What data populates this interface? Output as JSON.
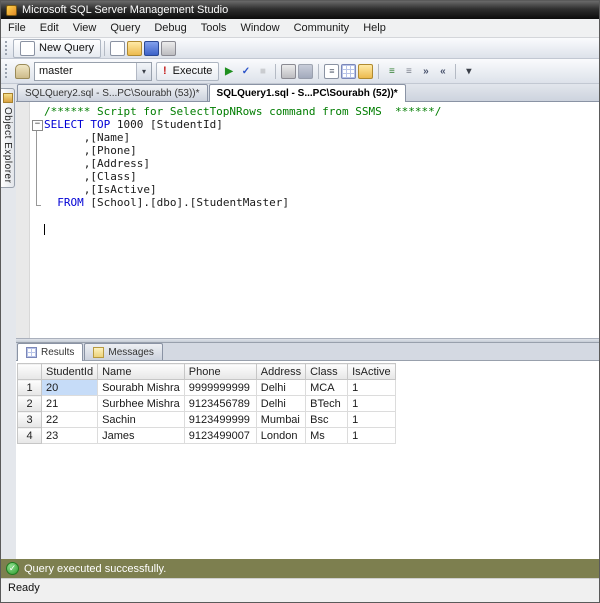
{
  "colors": {
    "keyword": "#0000d4",
    "comment": "#007d00",
    "plain_text": "#1a1a1a",
    "status_bar": "#7d7f4f",
    "selected_cell": "#c6dcf8"
  },
  "window": {
    "title": "Microsoft SQL Server Management Studio"
  },
  "menubar": {
    "items": [
      "File",
      "Edit",
      "View",
      "Query",
      "Debug",
      "Tools",
      "Window",
      "Community",
      "Help"
    ]
  },
  "toolbar_standard": {
    "new_query_label": "New Query",
    "icons": [
      {
        "name": "new-database-query-icon",
        "kind": "page"
      },
      {
        "name": "open-file-icon",
        "kind": "folder"
      },
      {
        "name": "save-icon",
        "kind": "save"
      },
      {
        "name": "print-icon",
        "kind": "print"
      }
    ]
  },
  "toolbar_sql": {
    "icons_before": [
      {
        "name": "available-databases-icon",
        "kind": "db"
      }
    ],
    "database": "master",
    "combo_arrow": "▾",
    "execute_bang": "!",
    "execute_label": "Execute",
    "icons_after": [
      {
        "name": "debug-play-icon",
        "glyph": "▶",
        "color": "#1e8f1e"
      },
      {
        "name": "parse-check-icon",
        "glyph": "✓",
        "color": "#2a52c8"
      },
      {
        "name": "cancel-query-icon",
        "glyph": "■",
        "color": "#a0a4ac",
        "disabled": true
      },
      {
        "sep": true
      },
      {
        "name": "query-options-icon",
        "kind": "print"
      },
      {
        "name": "intellisense-icon",
        "kind": "save",
        "disabled": true
      },
      {
        "sep": true
      },
      {
        "name": "results-to-text-icon",
        "kind": "text"
      },
      {
        "name": "results-to-grid-icon",
        "kind": "grid"
      },
      {
        "name": "results-to-file-icon",
        "kind": "folder"
      },
      {
        "sep": true
      },
      {
        "name": "comment-icon",
        "glyph": "≡",
        "color": "#2f7d2f"
      },
      {
        "name": "uncomment-icon",
        "glyph": "≡",
        "color": "#7a7f8a"
      },
      {
        "name": "indent-icon",
        "glyph": "»",
        "color": "#46506a"
      },
      {
        "name": "outdent-icon",
        "glyph": "«",
        "color": "#46506a"
      },
      {
        "sep": true
      },
      {
        "name": "toolbar-options-icon",
        "glyph": "▾",
        "color": "#3a3f48"
      }
    ]
  },
  "document_tabs": [
    {
      "label": "SQLQuery2.sql - S...PC\\Sourabh (53))*",
      "active": false
    },
    {
      "label": "SQLQuery1.sql - S...PC\\Sourabh (52))*",
      "active": true
    }
  ],
  "object_explorer": {
    "label": "Object Explorer"
  },
  "editor": {
    "lines": [
      {
        "fold": "",
        "tokens": [
          {
            "c": "com",
            "t": "/****** Script for SelectTopNRows command from SSMS  ******/"
          }
        ]
      },
      {
        "fold": "start",
        "tokens": [
          {
            "c": "kw",
            "t": "SELECT TOP "
          },
          {
            "c": "pl",
            "t": "1000 [StudentId]"
          }
        ]
      },
      {
        "fold": "mid",
        "tokens": [
          {
            "c": "pl",
            "t": "      ,[Name]"
          }
        ]
      },
      {
        "fold": "mid",
        "tokens": [
          {
            "c": "pl",
            "t": "      ,[Phone]"
          }
        ]
      },
      {
        "fold": "mid",
        "tokens": [
          {
            "c": "pl",
            "t": "      ,[Address]"
          }
        ]
      },
      {
        "fold": "mid",
        "tokens": [
          {
            "c": "pl",
            "t": "      ,[Class]"
          }
        ]
      },
      {
        "fold": "mid",
        "tokens": [
          {
            "c": "pl",
            "t": "      ,[IsActive]"
          }
        ]
      },
      {
        "fold": "end",
        "tokens": [
          {
            "c": "pl",
            "t": "  "
          },
          {
            "c": "kw",
            "t": "FROM"
          },
          {
            "c": "pl",
            "t": " [School].[dbo].[StudentMaster]"
          }
        ]
      },
      {
        "fold": "",
        "tokens": []
      },
      {
        "fold": "",
        "caret": true,
        "tokens": []
      }
    ]
  },
  "results": {
    "tabs": [
      {
        "label": "Results",
        "icon": "results-grid-icon",
        "active": true
      },
      {
        "label": "Messages",
        "icon": "messages-icon",
        "active": false
      }
    ],
    "columns": [
      "StudentId",
      "Name",
      "Phone",
      "Address",
      "Class",
      "IsActive"
    ],
    "rows": [
      [
        "20",
        "Sourabh Mishra",
        "9999999999",
        "Delhi",
        "MCA",
        "1"
      ],
      [
        "21",
        "Surbhee Mishra",
        "9123456789",
        "Delhi",
        "BTech",
        "1"
      ],
      [
        "22",
        "Sachin",
        "9123499999",
        "Mumbai",
        "Bsc",
        "1"
      ],
      [
        "23",
        "James",
        "9123499007",
        "London",
        "Ms",
        "1"
      ]
    ],
    "selected_cell": {
      "row": 0,
      "col": 0
    }
  },
  "status": {
    "check_glyph": "✓",
    "message": "Query executed successfully.",
    "ready": "Ready"
  }
}
